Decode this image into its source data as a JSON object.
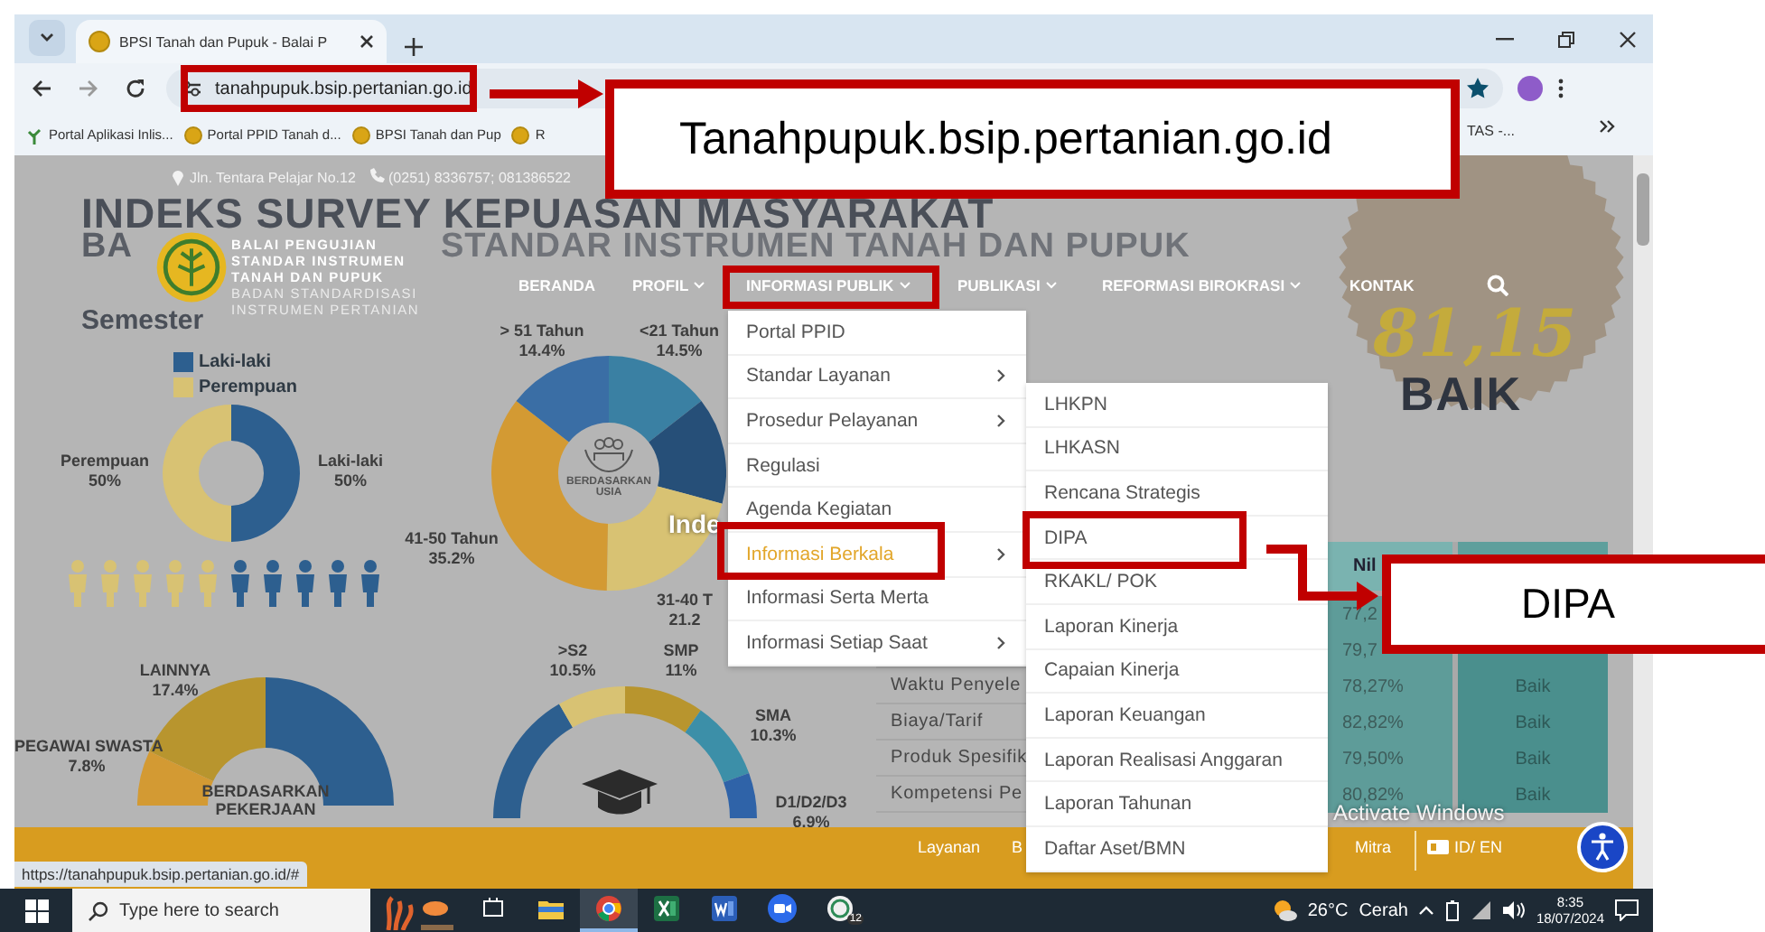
{
  "browser": {
    "tab_title": "BPSI Tanah dan Pupuk - Balai P",
    "url": "tanahpupuk.bsip.pertanian.go.id",
    "bookmarks": [
      {
        "label": "Portal Aplikasi Inlis...",
        "kind": "leaf"
      },
      {
        "label": "Portal PPID Tanah d...",
        "kind": "site"
      },
      {
        "label": "BPSI Tanah dan Pup",
        "kind": "site"
      },
      {
        "label": "R",
        "kind": "site"
      }
    ],
    "bookmark_tail": "TAS -...",
    "status_url": "https://tanahpupuk.bsip.pertanian.go.id/#"
  },
  "site": {
    "address": "Jln. Tentara Pelajar No.12",
    "phone": "(0251) 8336757; 081386522",
    "banner_title": "INDEKS SURVEY KEPUASAN MASYARAKAT",
    "banner_subtitle_start": "BA",
    "banner_subtitle": "STANDAR INSTRUMEN TANAH DAN PUPUK",
    "banner_period": "Semester",
    "logo_lines": [
      "BALAI PENGUJIAN",
      "STANDAR INSTRUMEN",
      "TANAH DAN PUPUK",
      "BADAN STANDARDISASI",
      "INSTRUMEN PERTANIAN"
    ],
    "nav": [
      {
        "label": "BERANDA",
        "dropdown": false
      },
      {
        "label": "PROFIL",
        "dropdown": true
      },
      {
        "label": "INFORMASI PUBLIK",
        "dropdown": true
      },
      {
        "label": "PUBLIKASI",
        "dropdown": true
      },
      {
        "label": "REFORMASI BIROKRASI",
        "dropdown": true
      },
      {
        "label": "KONTAK",
        "dropdown": false
      }
    ],
    "score": "81,15",
    "grade": "BAIK"
  },
  "infographic": {
    "legend": [
      "Laki-laki",
      "Perempuan"
    ],
    "gender_labels": [
      {
        "name": "Perempuan",
        "value": "50%"
      },
      {
        "name": "Laki-laki",
        "value": "50%"
      }
    ],
    "age_labels": [
      {
        "name": "> 51 Tahun",
        "value": "14.4%"
      },
      {
        "name": "<21 Tahun",
        "value": "14.5%"
      },
      {
        "name": "41-50 Tahun",
        "value": "35.2%"
      },
      {
        "name": "31-40 T",
        "value": "21.2"
      }
    ],
    "age_center": "BERDASARKAN USIA",
    "index_fragment": "Inde",
    "job_labels": [
      {
        "name": "LAINNYA",
        "value": "17.4%"
      },
      {
        "name": "PEGAWAI SWASTA",
        "value": "7.8%"
      }
    ],
    "job_center": "BERDASARKAN PEKERJAAN",
    "edu_labels": [
      {
        "name": ">S2",
        "value": "10.5%"
      },
      {
        "name": "SMP",
        "value": "11%"
      },
      {
        "name": "SMA",
        "value": "10.3%"
      },
      {
        "name": "D1/D2/D3",
        "value": "6.9%"
      }
    ]
  },
  "table": {
    "value_header": "Nil",
    "rows": [
      {
        "value": "77,2"
      },
      {
        "value": "79,7"
      },
      {
        "label": "Waktu Penyele",
        "value": "78,27%",
        "grade": "Baik"
      },
      {
        "label": "Biaya/Tarif",
        "value": "82,82%",
        "grade": "Baik"
      },
      {
        "label": "Produk Spesifik",
        "value": "79,50%",
        "grade": "Baik"
      },
      {
        "label": "Kompetensi Pe",
        "value": "80,82%",
        "grade": "Baik"
      }
    ]
  },
  "menu": {
    "items": [
      {
        "label": "Portal PPID",
        "submenu": false,
        "selected": false
      },
      {
        "label": "Standar Layanan",
        "submenu": true,
        "selected": false
      },
      {
        "label": "Prosedur Pelayanan",
        "submenu": true,
        "selected": false
      },
      {
        "label": "Regulasi",
        "submenu": false,
        "selected": false
      },
      {
        "label": "Agenda Kegiatan",
        "submenu": false,
        "selected": false
      },
      {
        "label": "Informasi Berkala",
        "submenu": true,
        "selected": true
      },
      {
        "label": "Informasi Serta Merta",
        "submenu": false,
        "selected": false
      },
      {
        "label": "Informasi Setiap Saat",
        "submenu": true,
        "selected": false
      }
    ]
  },
  "submenu": {
    "items": [
      "LHKPN",
      "LHKASN",
      "Rencana Strategis",
      "DIPA",
      "RKAKL/ POK",
      "Laporan Kinerja",
      "Capaian Kinerja",
      "Laporan Keuangan",
      "Laporan Realisasi Anggaran",
      "Laporan Tahunan",
      "Daftar Aset/BMN"
    ]
  },
  "footer": [
    "Layanan",
    "B",
    "Mitra",
    "ID/ EN"
  ],
  "os_notice": "Activate Windows",
  "annotations": {
    "url_callout": "Tanahpupuk.bsip.pertanian.go.id",
    "item_callout": "DIPA"
  },
  "taskbar": {
    "search_placeholder": "Type here to search",
    "apps": [
      {
        "kind": "taskview",
        "active": false
      },
      {
        "kind": "explorer",
        "active": false
      },
      {
        "kind": "chrome",
        "active": true
      },
      {
        "kind": "excel",
        "active": false
      },
      {
        "kind": "word",
        "active": false
      },
      {
        "kind": "zoom",
        "active": false
      },
      {
        "kind": "chat",
        "active": false,
        "badge": "12"
      }
    ],
    "temperature": "26°C",
    "weather": "Cerah",
    "time": "8:35",
    "date": "18/07/2024"
  }
}
